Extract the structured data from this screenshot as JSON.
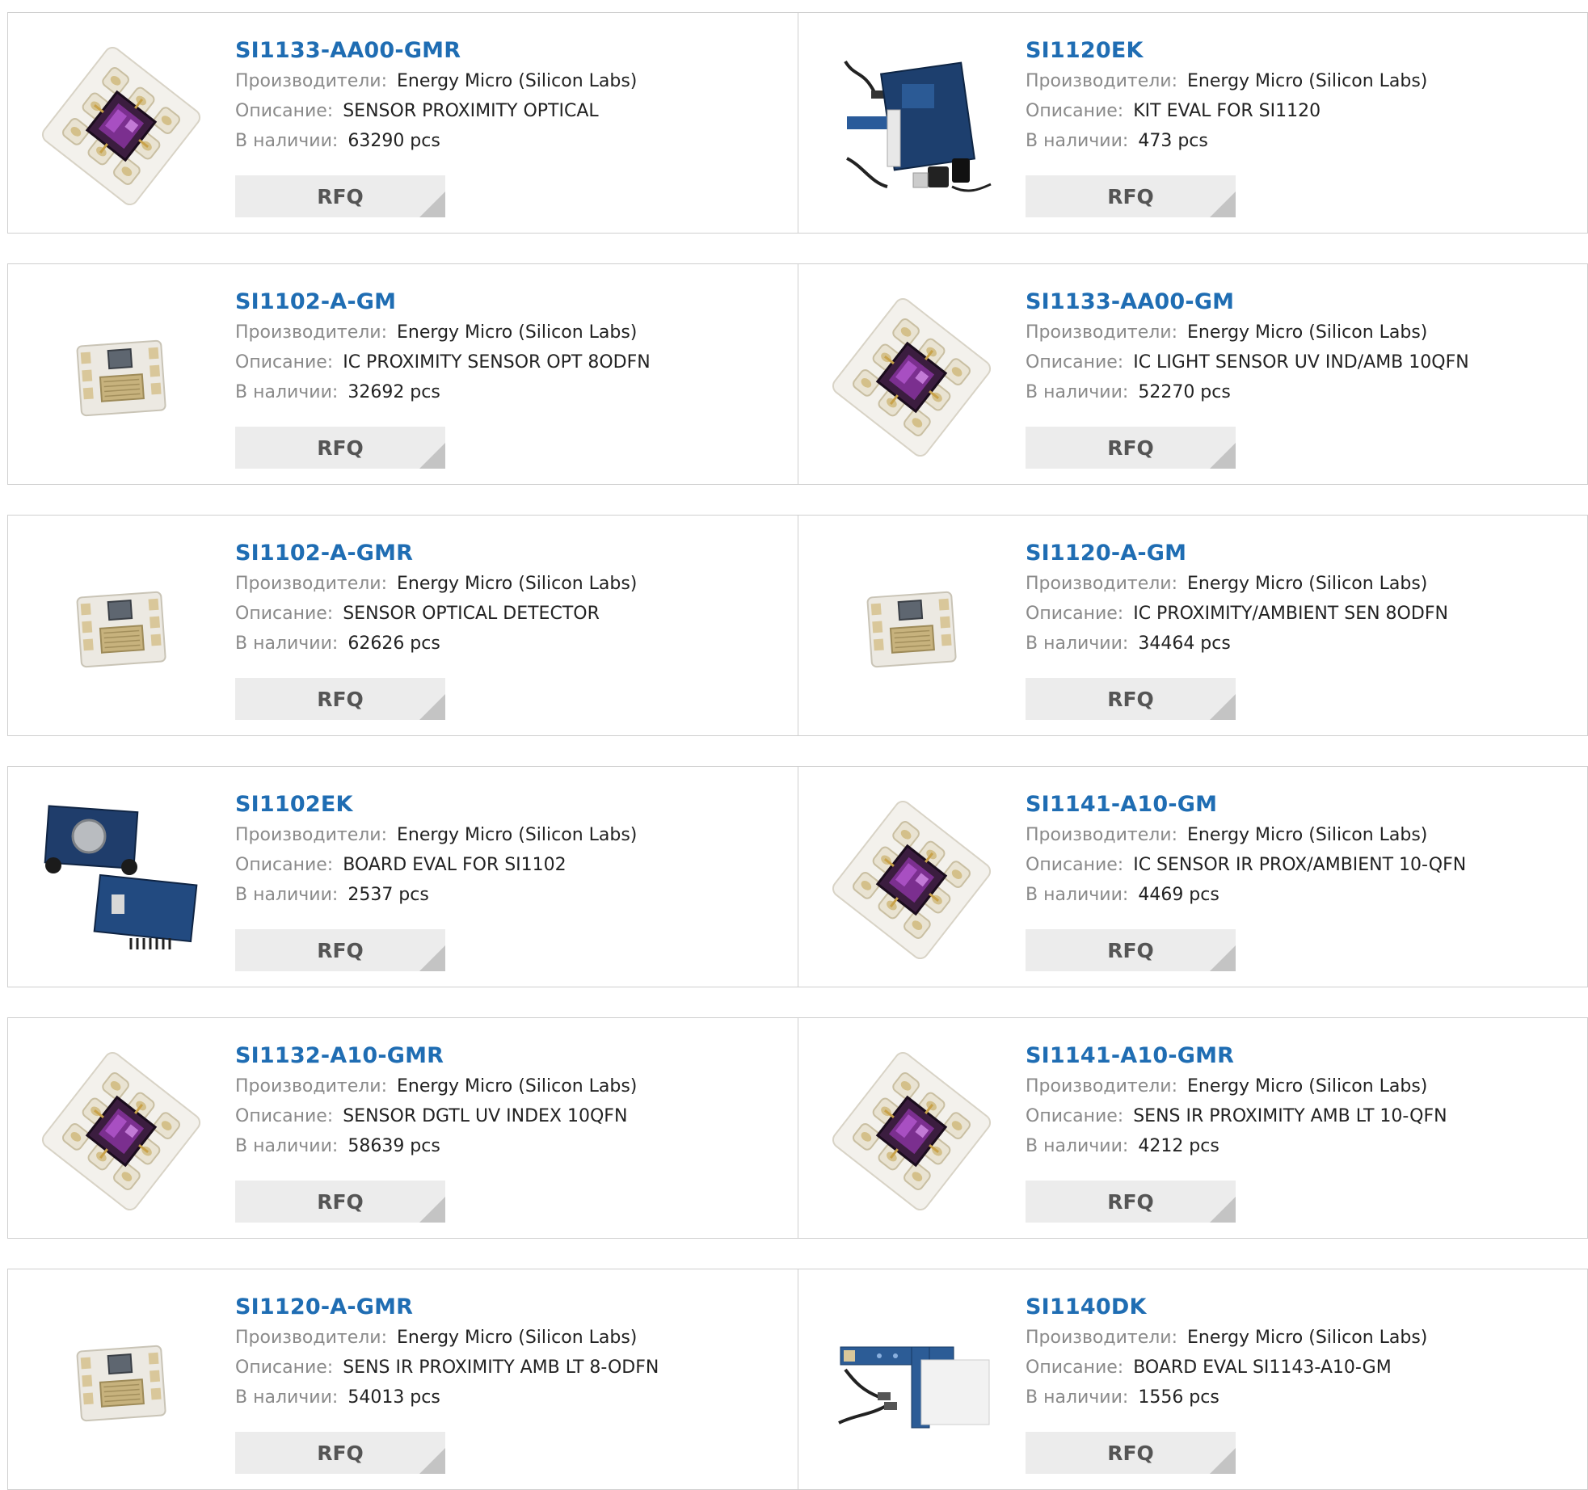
{
  "labels": {
    "manufacturer": "Производители:",
    "description": "Описание:",
    "stock": "В наличии:",
    "rfq": "RFQ"
  },
  "products": [
    {
      "part": "SI1133-AA00-GMR",
      "manufacturer": "Energy Micro (Silicon Labs)",
      "description": "SENSOR PROXIMITY OPTICAL",
      "stock": "63290 pcs",
      "image": "qfn-chip-purple"
    },
    {
      "part": "SI1120EK",
      "manufacturer": "Energy Micro (Silicon Labs)",
      "description": "KIT EVAL FOR SI1120",
      "stock": "473 pcs",
      "image": "eval-kit-board"
    },
    {
      "part": "SI1102-A-GM",
      "manufacturer": "Energy Micro (Silicon Labs)",
      "description": "IC PROXIMITY SENSOR OPT 8ODFN",
      "stock": "32692 pcs",
      "image": "odfn-chip-clear"
    },
    {
      "part": "SI1133-AA00-GM",
      "manufacturer": "Energy Micro (Silicon Labs)",
      "description": "IC LIGHT SENSOR UV IND/AMB 10QFN",
      "stock": "52270 pcs",
      "image": "qfn-chip-purple"
    },
    {
      "part": "SI1102-A-GMR",
      "manufacturer": "Energy Micro (Silicon Labs)",
      "description": "SENSOR OPTICAL DETECTOR",
      "stock": "62626 pcs",
      "image": "odfn-chip-clear"
    },
    {
      "part": "SI1120-A-GM",
      "manufacturer": "Energy Micro (Silicon Labs)",
      "description": "IC PROXIMITY/AMBIENT SEN 8ODFN",
      "stock": "34464 pcs",
      "image": "odfn-chip-clear"
    },
    {
      "part": "SI1102EK",
      "manufacturer": "Energy Micro (Silicon Labs)",
      "description": "BOARD EVAL FOR SI1102",
      "stock": "2537 pcs",
      "image": "eval-board-blue"
    },
    {
      "part": "SI1141-A10-GM",
      "manufacturer": "Energy Micro (Silicon Labs)",
      "description": "IC SENSOR IR PROX/AMBIENT 10-QFN",
      "stock": "4469 pcs",
      "image": "qfn-chip-purple"
    },
    {
      "part": "SI1132-A10-GMR",
      "manufacturer": "Energy Micro (Silicon Labs)",
      "description": "SENSOR DGTL UV INDEX 10QFN",
      "stock": "58639 pcs",
      "image": "qfn-chip-purple"
    },
    {
      "part": "SI1141-A10-GMR",
      "manufacturer": "Energy Micro (Silicon Labs)",
      "description": "SENS IR PROXIMITY AMB LT 10-QFN",
      "stock": "4212 pcs",
      "image": "qfn-chip-purple"
    },
    {
      "part": "SI1120-A-GMR",
      "manufacturer": "Energy Micro (Silicon Labs)",
      "description": "SENS IR PROXIMITY AMB LT 8-ODFN",
      "stock": "54013 pcs",
      "image": "odfn-chip-clear"
    },
    {
      "part": "SI1140DK",
      "manufacturer": "Energy Micro (Silicon Labs)",
      "description": "BOARD EVAL SI1143-A10-GM",
      "stock": "1556 pcs",
      "image": "dev-kit-touch-board"
    }
  ],
  "colors": {
    "part_link": "#1f6db3",
    "label": "#8a8a8a",
    "value": "#222222",
    "rfq_bg": "#ececec",
    "rfq_corner": "#c4c4c4",
    "border": "#cfcfcf"
  }
}
